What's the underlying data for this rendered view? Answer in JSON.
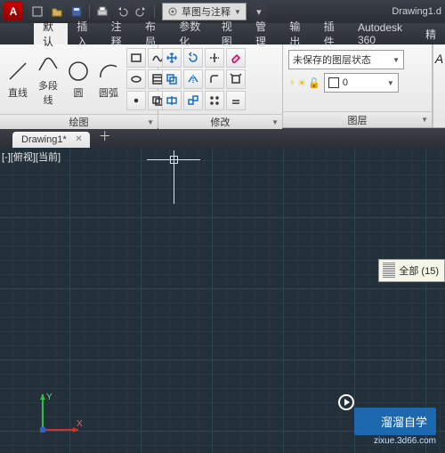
{
  "title": "Drawing1.d",
  "qat": {
    "workspace": "草图与注释"
  },
  "tabs": {
    "t0": "默认",
    "t1": "插入",
    "t2": "注释",
    "t3": "布局",
    "t4": "参数化",
    "t5": "视图",
    "t6": "管理",
    "t7": "输出",
    "t8": "插件",
    "t9": "Autodesk 360",
    "t10": "精"
  },
  "draw": {
    "panel": "绘图",
    "line": "直线",
    "polyline": "多段线",
    "circle": "圆",
    "arc": "圆弧"
  },
  "modify": {
    "panel": "修改"
  },
  "layers": {
    "panel": "图层",
    "state": "未保存的图层状态",
    "current": "0"
  },
  "doc": {
    "tab": "Drawing1*"
  },
  "view": {
    "label": "[-][俯视][当前]"
  },
  "snap": {
    "label": "全部 (15)"
  },
  "ucs": {
    "x": "X",
    "y": "Y"
  },
  "watermark": {
    "brand": "溜溜自学",
    "url": "zixue.3d66.com"
  },
  "rightstub": {
    "char": "A"
  }
}
